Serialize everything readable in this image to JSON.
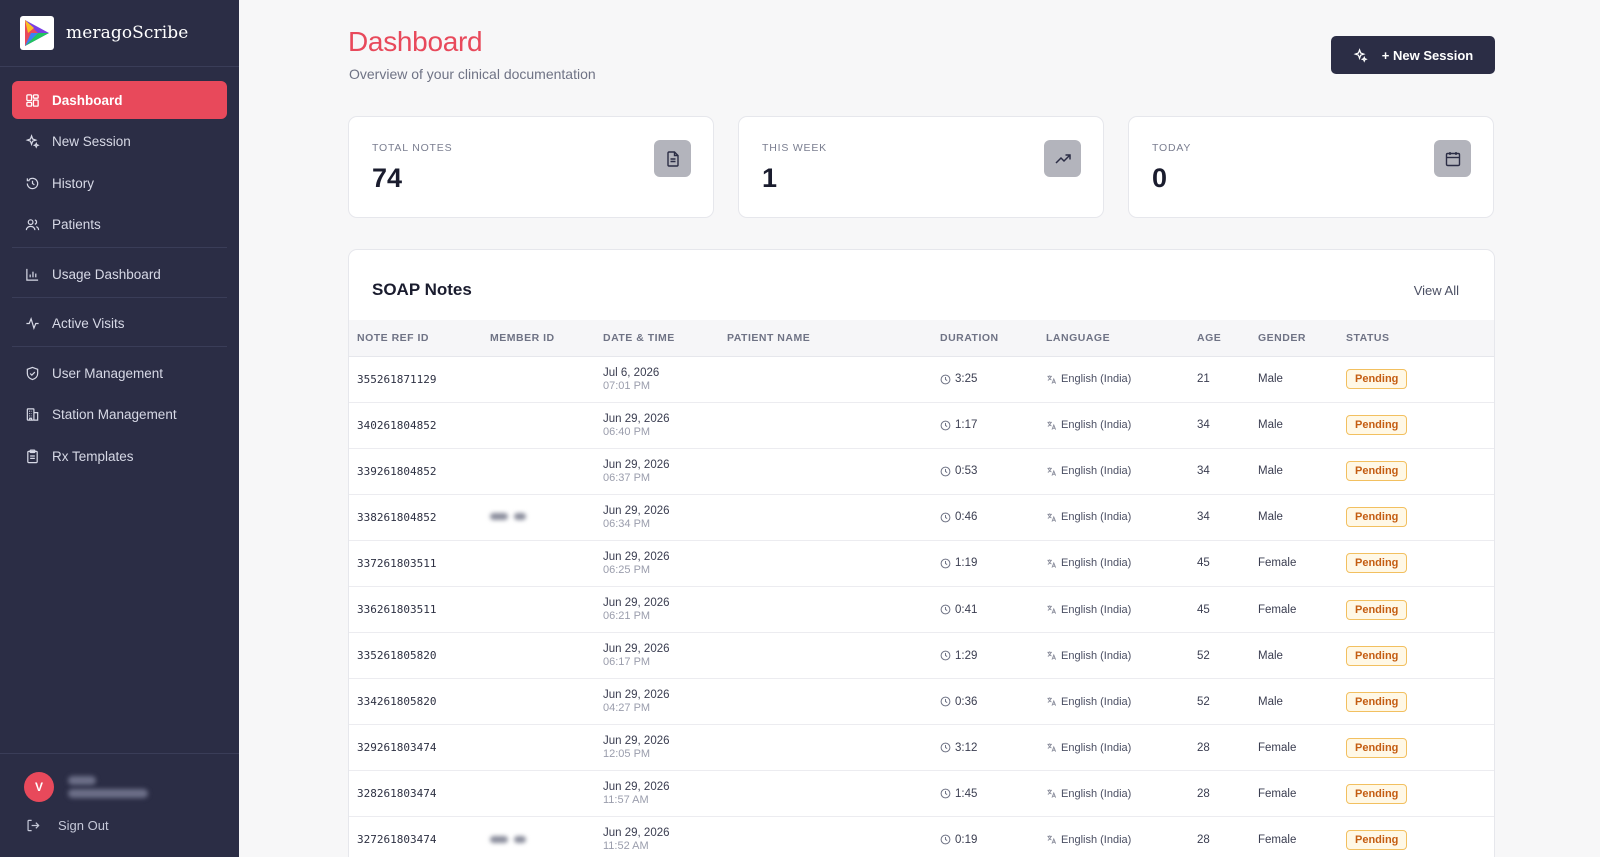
{
  "brand": {
    "name": "meragoScribe"
  },
  "nav": [
    {
      "label": "Dashboard",
      "icon": "dashboard-grid-icon",
      "active": true
    },
    {
      "label": "New Session",
      "icon": "sparkles-icon"
    },
    {
      "label": "History",
      "icon": "history-icon"
    },
    {
      "label": "Patients",
      "icon": "users-icon"
    },
    {
      "label": "Usage Dashboard",
      "icon": "bar-chart-icon"
    },
    {
      "label": "Active Visits",
      "icon": "activity-icon"
    },
    {
      "label": "User Management",
      "icon": "shield-icon"
    },
    {
      "label": "Station Management",
      "icon": "building-icon"
    },
    {
      "label": "Rx Templates",
      "icon": "clipboard-icon"
    }
  ],
  "user": {
    "avatar_initial": "V"
  },
  "sidebar_footer": {
    "signout_label": "Sign Out"
  },
  "header": {
    "title": "Dashboard",
    "subtitle": "Overview of your clinical documentation",
    "new_session_label": "+ New Session"
  },
  "stats": [
    {
      "label": "TOTAL NOTES",
      "value": "74",
      "icon": "document-icon"
    },
    {
      "label": "THIS WEEK",
      "value": "1",
      "icon": "trending-up-icon"
    },
    {
      "label": "TODAY",
      "value": "0",
      "icon": "calendar-icon"
    }
  ],
  "soap": {
    "title": "SOAP Notes",
    "view_all_label": "View All",
    "columns": [
      "NOTE REF ID",
      "MEMBER ID",
      "DATE & TIME",
      "PATIENT NAME",
      "DURATION",
      "LANGUAGE",
      "AGE",
      "GENDER",
      "STATUS"
    ],
    "rows": [
      {
        "ref": "355261871129",
        "member_blurred": false,
        "date": "Jul 6, 2026",
        "time": "07:01 PM",
        "patient": "",
        "duration": "3:25",
        "language": "English (India)",
        "age": "21",
        "gender": "Male",
        "status": "Pending"
      },
      {
        "ref": "340261804852",
        "member_blurred": false,
        "date": "Jun 29, 2026",
        "time": "06:40 PM",
        "patient": "",
        "duration": "1:17",
        "language": "English (India)",
        "age": "34",
        "gender": "Male",
        "status": "Pending"
      },
      {
        "ref": "339261804852",
        "member_blurred": false,
        "date": "Jun 29, 2026",
        "time": "06:37 PM",
        "patient": "",
        "duration": "0:53",
        "language": "English (India)",
        "age": "34",
        "gender": "Male",
        "status": "Pending"
      },
      {
        "ref": "338261804852",
        "member_blurred": true,
        "date": "Jun 29, 2026",
        "time": "06:34 PM",
        "patient": "",
        "duration": "0:46",
        "language": "English (India)",
        "age": "34",
        "gender": "Male",
        "status": "Pending"
      },
      {
        "ref": "337261803511",
        "member_blurred": false,
        "date": "Jun 29, 2026",
        "time": "06:25 PM",
        "patient": "",
        "duration": "1:19",
        "language": "English (India)",
        "age": "45",
        "gender": "Female",
        "status": "Pending"
      },
      {
        "ref": "336261803511",
        "member_blurred": false,
        "date": "Jun 29, 2026",
        "time": "06:21 PM",
        "patient": "",
        "duration": "0:41",
        "language": "English (India)",
        "age": "45",
        "gender": "Female",
        "status": "Pending"
      },
      {
        "ref": "335261805820",
        "member_blurred": false,
        "date": "Jun 29, 2026",
        "time": "06:17 PM",
        "patient": "",
        "duration": "1:29",
        "language": "English (India)",
        "age": "52",
        "gender": "Male",
        "status": "Pending"
      },
      {
        "ref": "334261805820",
        "member_blurred": false,
        "date": "Jun 29, 2026",
        "time": "04:27 PM",
        "patient": "",
        "duration": "0:36",
        "language": "English (India)",
        "age": "52",
        "gender": "Male",
        "status": "Pending"
      },
      {
        "ref": "329261803474",
        "member_blurred": false,
        "date": "Jun 29, 2026",
        "time": "12:05 PM",
        "patient": "",
        "duration": "3:12",
        "language": "English (India)",
        "age": "28",
        "gender": "Female",
        "status": "Pending"
      },
      {
        "ref": "328261803474",
        "member_blurred": false,
        "date": "Jun 29, 2026",
        "time": "11:57 AM",
        "patient": "",
        "duration": "1:45",
        "language": "English (India)",
        "age": "28",
        "gender": "Female",
        "status": "Pending"
      },
      {
        "ref": "327261803474",
        "member_blurred": true,
        "date": "Jun 29, 2026",
        "time": "11:52 AM",
        "patient": "",
        "duration": "0:19",
        "language": "English (India)",
        "age": "28",
        "gender": "Female",
        "status": "Pending"
      }
    ]
  },
  "colors": {
    "sidebar": "#2b2d45",
    "accent": "#e8495b",
    "pending_text": "#c45d12",
    "pending_border": "#f2c060"
  }
}
